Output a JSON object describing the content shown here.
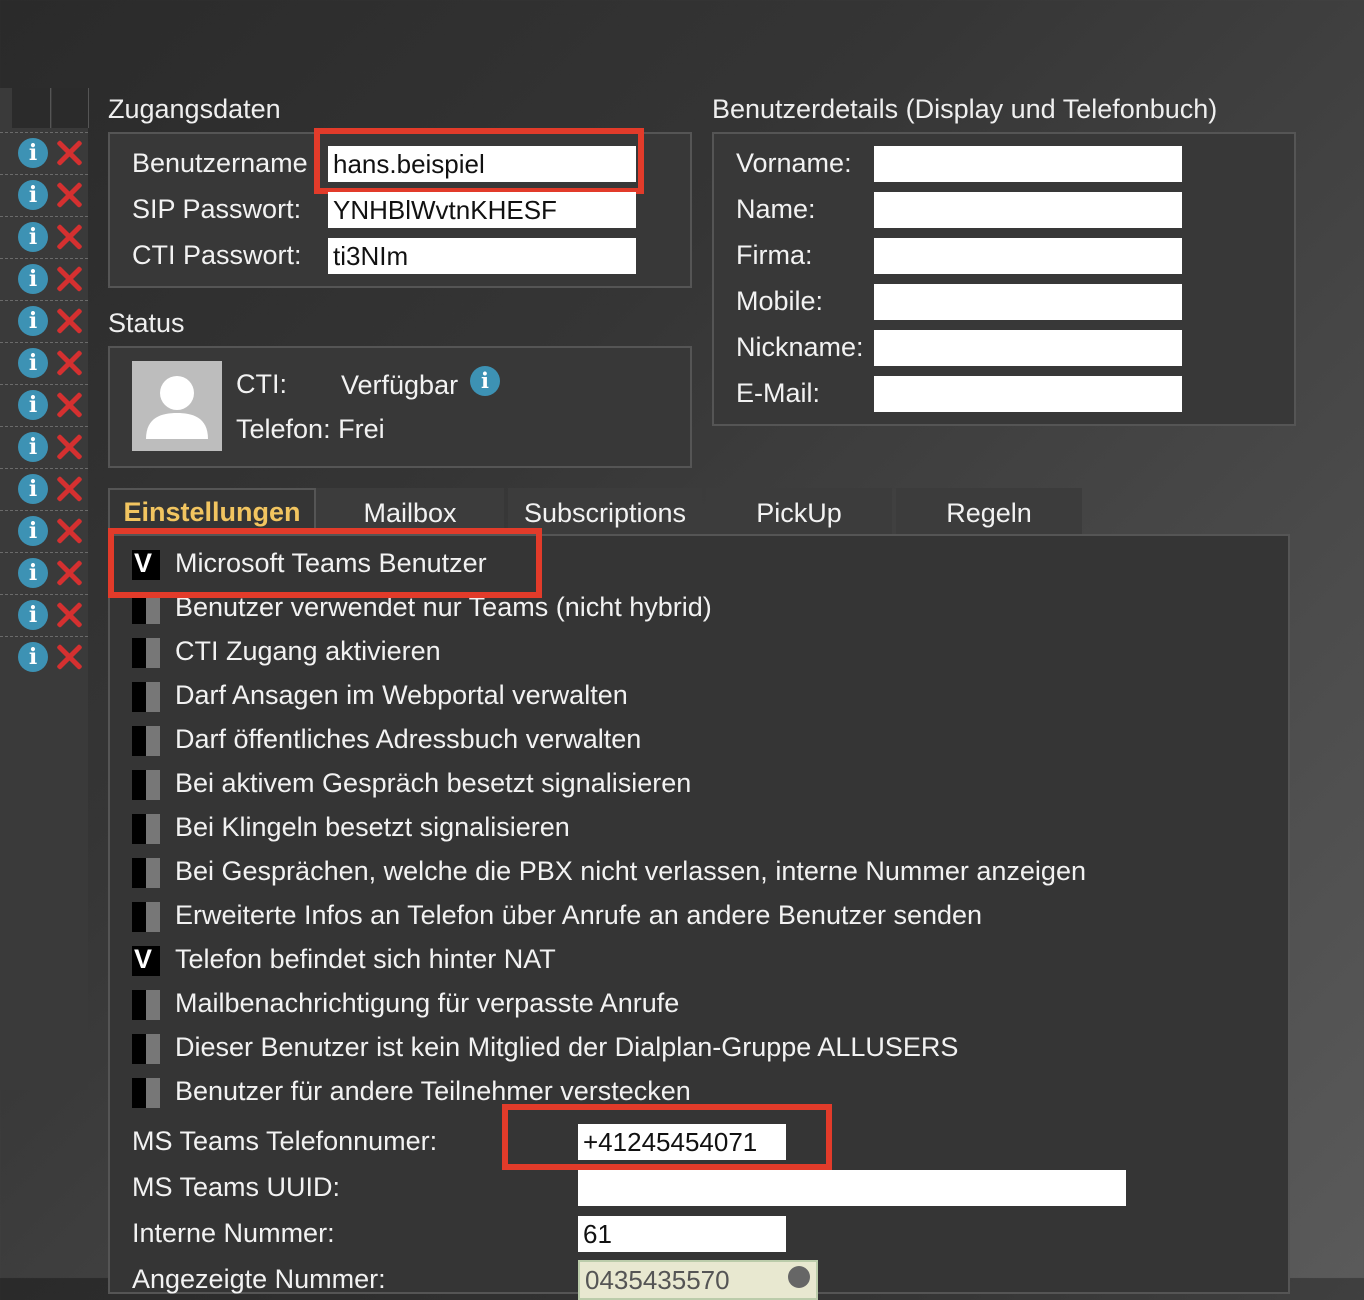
{
  "login": {
    "title": "Zugangsdaten",
    "username_label": "Benutzername",
    "username_value": "hans.beispiel",
    "sip_label": "SIP Passwort:",
    "sip_value": "YNHBlWvtnKHESF",
    "cti_label": "CTI Passwort:",
    "cti_value": "ti3NIm"
  },
  "details": {
    "title": "Benutzerdetails (Display und Telefonbuch)",
    "fields": [
      {
        "label": "Vorname:",
        "value": ""
      },
      {
        "label": "Name:",
        "value": ""
      },
      {
        "label": "Firma:",
        "value": ""
      },
      {
        "label": "Mobile:",
        "value": ""
      },
      {
        "label": "Nickname:",
        "value": ""
      },
      {
        "label": "E-Mail:",
        "value": ""
      }
    ]
  },
  "status": {
    "title": "Status",
    "cti_label": "CTI:",
    "cti_value": "Verfügbar",
    "phone_label": "Telefon:",
    "phone_value": "Frei"
  },
  "tabs": [
    {
      "label": "Einstellungen",
      "active": true
    },
    {
      "label": "Mailbox",
      "active": false
    },
    {
      "label": "Subscriptions",
      "active": false
    },
    {
      "label": "PickUp",
      "active": false
    },
    {
      "label": "Regeln",
      "active": false
    }
  ],
  "settings": [
    {
      "label": "Microsoft Teams Benutzer",
      "checked": true
    },
    {
      "label": "Benutzer verwendet nur Teams (nicht hybrid)",
      "checked": false
    },
    {
      "label": "CTI Zugang aktivieren",
      "checked": false
    },
    {
      "label": "Darf Ansagen im Webportal verwalten",
      "checked": false
    },
    {
      "label": "Darf öffentliches Adressbuch verwalten",
      "checked": false
    },
    {
      "label": "Bei aktivem Gespräch besetzt signalisieren",
      "checked": false
    },
    {
      "label": "Bei Klingeln besetzt signalisieren",
      "checked": false
    },
    {
      "label": "Bei Gesprächen, welche die PBX nicht verlassen, interne Nummer anzeigen",
      "checked": false
    },
    {
      "label": "Erweiterte Infos an Telefon über Anrufe an andere Benutzer senden",
      "checked": false
    },
    {
      "label": "Telefon befindet sich hinter NAT",
      "checked": true
    },
    {
      "label": "Mailbenachrichtigung für verpasste Anrufe",
      "checked": false
    },
    {
      "label": "Dieser Benutzer ist kein Mitglied der Dialplan-Gruppe ALLUSERS",
      "checked": false
    },
    {
      "label": "Benutzer für andere Teilnehmer verstecken",
      "checked": false
    }
  ],
  "checkmark": "V",
  "bottom_fields": {
    "teams_phone_label": "MS Teams Telefonnumer:",
    "teams_phone_value": "+41245454071",
    "teams_uuid_label": "MS Teams UUID:",
    "teams_uuid_value": "",
    "internal_label": "Interne Nummer:",
    "internal_value": "61",
    "display_label": "Angezeigte Nummer:",
    "display_value": "0435435570"
  },
  "icons": {
    "info": "i"
  },
  "colors": {
    "highlight": "#e23b2a",
    "active_tab": "#f2c560",
    "info": "#3d92b4",
    "delete": "#d53030"
  }
}
